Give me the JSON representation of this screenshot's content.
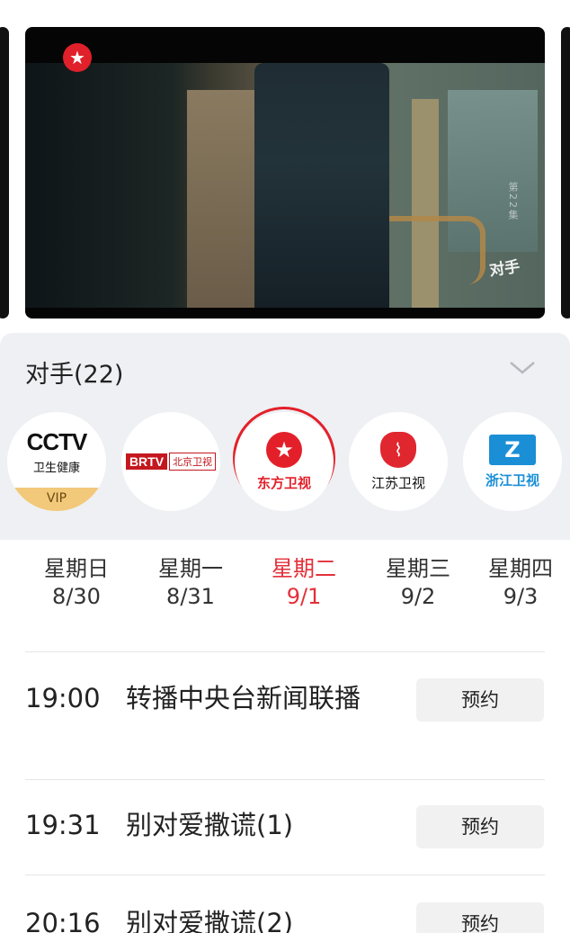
{
  "player": {
    "channel_logo_icon": "dragon-tv-star-icon",
    "episode_mark": "第22集",
    "show_mark": "对手"
  },
  "schedule": {
    "title": "对手(22)",
    "collapse_icon": "chevron-down-icon",
    "channels": [
      {
        "name": "CCTV",
        "sub": "卫生健康",
        "badge": "VIP"
      },
      {
        "name": "BRTV",
        "sub": "北京卫视"
      },
      {
        "name": "东方卫视",
        "selected": true
      },
      {
        "name": "江苏卫视"
      },
      {
        "name": "浙江卫视"
      }
    ]
  },
  "days": [
    {
      "weekday": "星期日",
      "date": "8/30"
    },
    {
      "weekday": "星期一",
      "date": "8/31"
    },
    {
      "weekday": "星期二",
      "date": "9/1",
      "active": true
    },
    {
      "weekday": "星期三",
      "date": "9/2"
    },
    {
      "weekday": "星期四",
      "date": "9/3"
    }
  ],
  "programs": [
    {
      "time": "19:00",
      "title": "转播中央台新闻联播",
      "action": "预约"
    },
    {
      "time": "19:31",
      "title": "别对爱撒谎(1)",
      "action": "预约"
    },
    {
      "time": "20:16",
      "title": "别对爱撒谎(2)",
      "action": "预约"
    }
  ],
  "colors": {
    "accent": "#e3303a",
    "panel_bg": "#eef0f3",
    "vip": "#f2c87a"
  }
}
